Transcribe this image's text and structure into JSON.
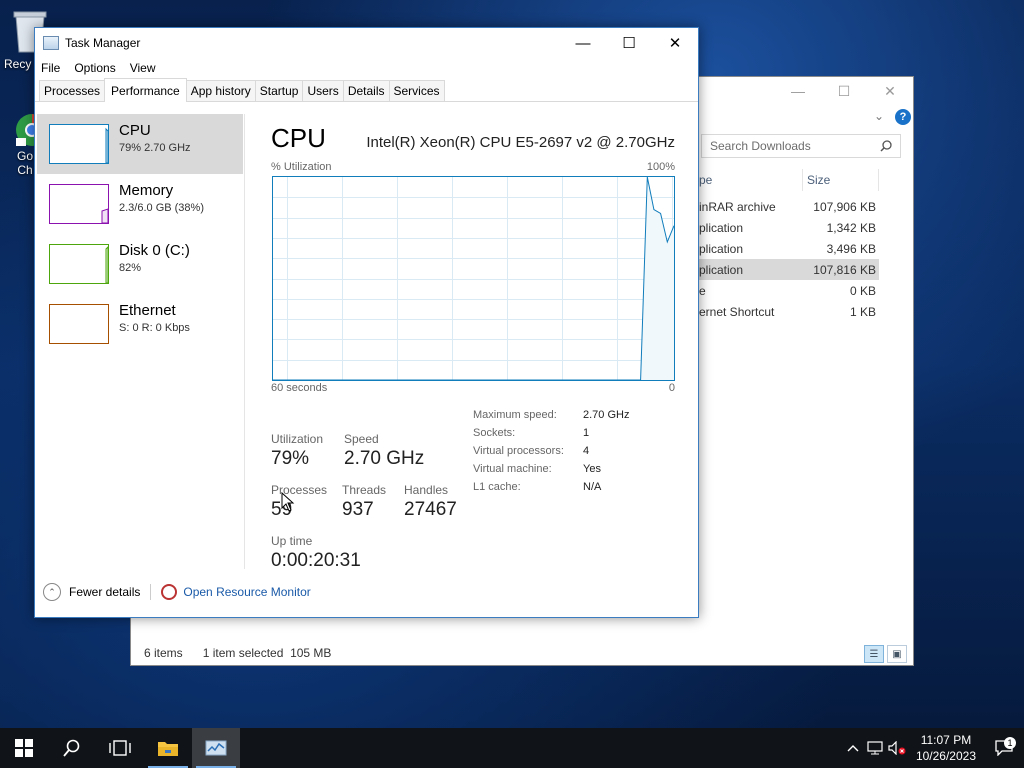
{
  "desktop": {
    "icons": [
      {
        "label": "Recy"
      },
      {
        "label": "Go\nCh"
      }
    ]
  },
  "explorer": {
    "search_placeholder": "Search Downloads",
    "columns": [
      "pe",
      "Size"
    ],
    "rows": [
      {
        "type": "inRAR archive",
        "size": "107,906 KB",
        "selected": false
      },
      {
        "type": "plication",
        "size": "1,342 KB",
        "selected": false
      },
      {
        "type": "plication",
        "size": "3,496 KB",
        "selected": false
      },
      {
        "type": "plication",
        "size": "107,816 KB",
        "selected": true
      },
      {
        "type": "e",
        "size": "0 KB",
        "selected": false
      },
      {
        "type": "ernet Shortcut",
        "size": "1 KB",
        "selected": false
      }
    ],
    "status": {
      "items": "6 items",
      "selected": "1 item selected  105 MB"
    }
  },
  "taskmanager": {
    "title": "Task Manager",
    "menu": [
      "File",
      "Options",
      "View"
    ],
    "tabs": [
      "Processes",
      "Performance",
      "App history",
      "Startup",
      "Users",
      "Details",
      "Services"
    ],
    "active_tab": "Performance",
    "resources": [
      {
        "name": "CPU",
        "sub": "79% 2.70 GHz",
        "color": "#117dbb",
        "selected": true
      },
      {
        "name": "Memory",
        "sub": "2.3/6.0 GB (38%)",
        "color": "#8b12ae",
        "selected": false
      },
      {
        "name": "Disk 0 (C:)",
        "sub": "82%",
        "color": "#4da60c",
        "selected": false
      },
      {
        "name": "Ethernet",
        "sub": "S: 0 R: 0 Kbps",
        "color": "#a74f01",
        "selected": false
      }
    ],
    "cpu": {
      "heading": "CPU",
      "model": "Intel(R) Xeon(R) CPU E5-2697 v2 @ 2.70GHz",
      "util_label": "% Utilization",
      "util_max": "100%",
      "x_left": "60 seconds",
      "x_right": "0",
      "stats": {
        "utilization": {
          "label": "Utilization",
          "value": "79%"
        },
        "speed": {
          "label": "Speed",
          "value": "2.70 GHz"
        },
        "processes": {
          "label": "Processes",
          "value": "59"
        },
        "threads": {
          "label": "Threads",
          "value": "937"
        },
        "handles": {
          "label": "Handles",
          "value": "27467"
        },
        "uptime": {
          "label": "Up time",
          "value": "0:00:20:31"
        }
      },
      "details": [
        {
          "k": "Maximum speed:",
          "v": "2.70 GHz"
        },
        {
          "k": "Sockets:",
          "v": "1"
        },
        {
          "k": "Virtual processors:",
          "v": "4"
        },
        {
          "k": "Virtual machine:",
          "v": "Yes"
        },
        {
          "k": "L1 cache:",
          "v": "N/A"
        }
      ],
      "history_pct": [
        0,
        0,
        0,
        0,
        0,
        0,
        0,
        0,
        0,
        0,
        0,
        0,
        0,
        0,
        0,
        0,
        0,
        0,
        0,
        0,
        0,
        0,
        0,
        0,
        0,
        0,
        0,
        0,
        0,
        0,
        0,
        0,
        0,
        0,
        0,
        0,
        0,
        0,
        0,
        0,
        0,
        0,
        0,
        0,
        0,
        0,
        0,
        0,
        0,
        0,
        0,
        0,
        0,
        0,
        0,
        0,
        100,
        84,
        82,
        68,
        76
      ]
    },
    "footer": {
      "fewer": "Fewer details",
      "monitor": "Open Resource Monitor"
    }
  },
  "taskbar": {
    "time": "11:07 PM",
    "date": "10/26/2023",
    "notif_count": "1"
  }
}
